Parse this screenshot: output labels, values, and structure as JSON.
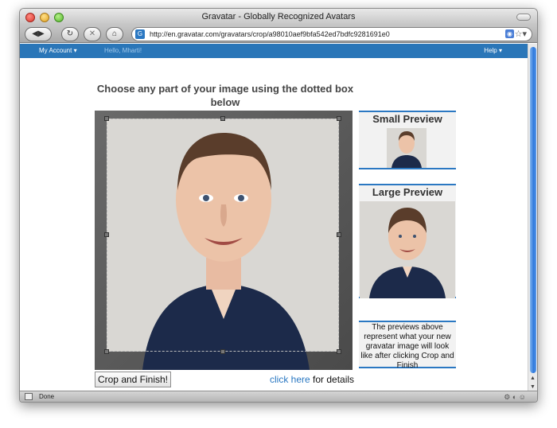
{
  "window": {
    "title": "Gravatar - Globally Recognized Avatars"
  },
  "toolbar": {
    "back_icon": "◀▶",
    "reload_icon": "↻",
    "stop_icon": "✕",
    "home_icon": "⌂",
    "url": "http://en.gravatar.com/gravatars/crop/a98010aef9bfa542ed7bdfc9281691e0"
  },
  "navbar": {
    "account": "My Account ▾",
    "hello": "Hello, Mharti!",
    "help": "Help ▾"
  },
  "main": {
    "heading": "Choose any part of your image using the dotted box below",
    "crop_button": "Crop and Finish!",
    "details_link": "click here",
    "details_text": " for details"
  },
  "previews": {
    "small_title": "Small Preview",
    "large_title": "Large Preview",
    "note": "The previews above represent what your new gravatar image will look like after clicking Crop and Finish"
  },
  "statusbar": {
    "text": "Done"
  },
  "colors": {
    "accent": "#2b78c2",
    "navbar": "#2a76b8"
  }
}
